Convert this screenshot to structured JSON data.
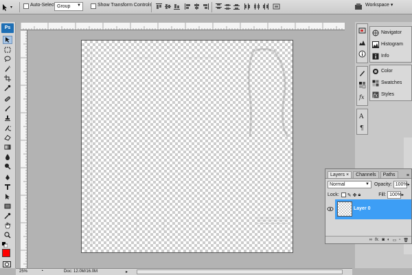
{
  "options_bar": {
    "auto_select_label": "Auto-Select:",
    "auto_select_checked": false,
    "auto_select_value": "Group",
    "show_transform_label": "Show Transform Controls",
    "show_transform_checked": false,
    "workspace_label": "Workspace"
  },
  "toolbox": {
    "logo": "Ps",
    "foreground_color": "#ff0000"
  },
  "right_dock": {
    "group1": [
      {
        "label": "Navigator",
        "icon": "navigator-icon"
      },
      {
        "label": "Histogram",
        "icon": "histogram-icon"
      },
      {
        "label": "Info",
        "icon": "info-icon"
      }
    ],
    "group2": [
      {
        "label": "Color",
        "icon": "color-icon"
      },
      {
        "label": "Swatches",
        "icon": "swatches-icon"
      },
      {
        "label": "Styles",
        "icon": "styles-icon"
      }
    ]
  },
  "layers_panel": {
    "tabs": [
      "Layers",
      "Channels",
      "Paths"
    ],
    "active_tab": "Layers",
    "blend_mode": "Normal",
    "opacity_label": "Opacity:",
    "opacity_value": "100%",
    "lock_label": "Lock:",
    "fill_label": "Fill:",
    "fill_value": "100%",
    "layers": [
      {
        "name": "Layer 0",
        "selected": true,
        "visible": true
      }
    ],
    "accent": "#3d9ef5"
  },
  "status_bar": {
    "zoom": "25%",
    "doc_info": "Doc: 12.0M/16.0M"
  }
}
